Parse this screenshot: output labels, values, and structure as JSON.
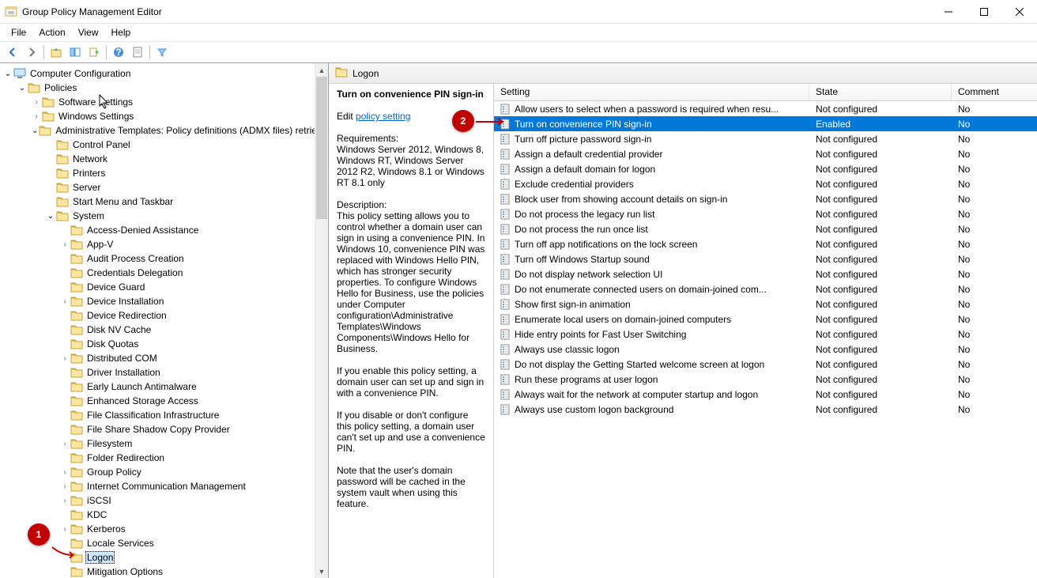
{
  "window": {
    "title": "Group Policy Management Editor"
  },
  "menubar": {
    "file": "File",
    "action": "Action",
    "view": "View",
    "help": "Help"
  },
  "tree": {
    "root": "Computer Configuration",
    "policies": "Policies",
    "software_settings": "Software Settings",
    "windows_settings": "Windows Settings",
    "admin_templates": "Administrative Templates: Policy definitions (ADMX files) retrieved from the central store",
    "control_panel": "Control Panel",
    "network": "Network",
    "printers": "Printers",
    "server": "Server",
    "start_menu": "Start Menu and Taskbar",
    "system": "System",
    "system_children": [
      "Access-Denied Assistance",
      "App-V",
      "Audit Process Creation",
      "Credentials Delegation",
      "Device Guard",
      "Device Installation",
      "Device Redirection",
      "Disk NV Cache",
      "Disk Quotas",
      "Distributed COM",
      "Driver Installation",
      "Early Launch Antimalware",
      "Enhanced Storage Access",
      "File Classification Infrastructure",
      "File Share Shadow Copy Provider",
      "Filesystem",
      "Folder Redirection",
      "Group Policy",
      "Internet Communication Management",
      "iSCSI",
      "KDC",
      "Kerberos",
      "Locale Services",
      "Logon",
      "Mitigation Options"
    ],
    "system_child_expanders": {
      "App-V": true,
      "Device Installation": true,
      "Distributed COM": true,
      "Filesystem": true,
      "Group Policy": true,
      "Internet Communication Management": true,
      "iSCSI": true,
      "Kerberos": true
    },
    "selected_tree_item": "Logon"
  },
  "right": {
    "header_label": "Logon",
    "setting_title": "Turn on convenience PIN sign-in",
    "edit_prefix": "Edit",
    "edit_link": "policy setting",
    "requirements_label": "Requirements:",
    "requirements_text": "Windows Server 2012, Windows 8, Windows RT, Windows Server 2012 R2, Windows 8.1 or Windows RT 8.1 only",
    "description_label": "Description:",
    "description_paragraphs": [
      "This policy setting allows you to control whether a domain user can sign in using a convenience PIN. In Windows 10, convenience PIN was replaced with Windows Hello PIN, which has stronger security properties. To configure Windows Hello for Business, use the policies under Computer configuration\\Administrative Templates\\Windows Components\\Windows Hello for Business.",
      "If you enable this policy setting, a domain user can set up and sign in with a convenience PIN.",
      "If you disable or don't configure this policy setting, a domain user can't set up and use a convenience PIN.",
      "Note that the user's domain password will be cached in the system vault when using this feature."
    ],
    "columns": {
      "setting": "Setting",
      "state": "State",
      "comment": "Comment"
    },
    "rows": [
      {
        "name": "Allow users to select when a password is required when resu...",
        "state": "Not configured",
        "comment": "No"
      },
      {
        "name": "Turn on convenience PIN sign-in",
        "state": "Enabled",
        "comment": "No",
        "selected": true
      },
      {
        "name": "Turn off picture password sign-in",
        "state": "Not configured",
        "comment": "No"
      },
      {
        "name": "Assign a default credential provider",
        "state": "Not configured",
        "comment": "No"
      },
      {
        "name": "Assign a default domain for logon",
        "state": "Not configured",
        "comment": "No"
      },
      {
        "name": "Exclude credential providers",
        "state": "Not configured",
        "comment": "No"
      },
      {
        "name": "Block user from showing account details on sign-in",
        "state": "Not configured",
        "comment": "No"
      },
      {
        "name": "Do not process the legacy run list",
        "state": "Not configured",
        "comment": "No"
      },
      {
        "name": "Do not process the run once list",
        "state": "Not configured",
        "comment": "No"
      },
      {
        "name": "Turn off app notifications on the lock screen",
        "state": "Not configured",
        "comment": "No"
      },
      {
        "name": "Turn off Windows Startup sound",
        "state": "Not configured",
        "comment": "No"
      },
      {
        "name": "Do not display network selection UI",
        "state": "Not configured",
        "comment": "No"
      },
      {
        "name": "Do not enumerate connected users on domain-joined com...",
        "state": "Not configured",
        "comment": "No"
      },
      {
        "name": "Show first sign-in animation",
        "state": "Not configured",
        "comment": "No"
      },
      {
        "name": "Enumerate local users on domain-joined computers",
        "state": "Not configured",
        "comment": "No"
      },
      {
        "name": "Hide entry points for Fast User Switching",
        "state": "Not configured",
        "comment": "No"
      },
      {
        "name": "Always use classic logon",
        "state": "Not configured",
        "comment": "No"
      },
      {
        "name": "Do not display the Getting Started welcome screen at logon",
        "state": "Not configured",
        "comment": "No"
      },
      {
        "name": "Run these programs at user logon",
        "state": "Not configured",
        "comment": "No"
      },
      {
        "name": "Always wait for the network at computer startup and logon",
        "state": "Not configured",
        "comment": "No"
      },
      {
        "name": "Always use custom logon background",
        "state": "Not configured",
        "comment": "No"
      }
    ]
  },
  "annotations": {
    "badge1": "1",
    "badge2": "2"
  }
}
